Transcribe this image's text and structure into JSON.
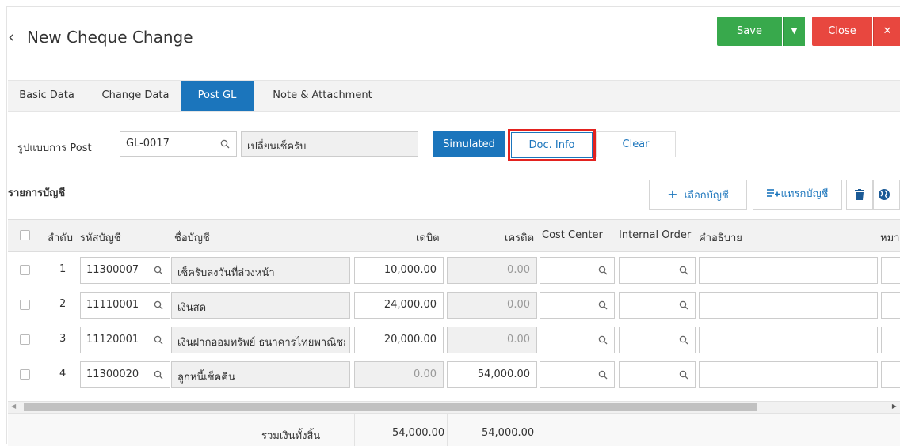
{
  "header": {
    "back_icon": "chevron-left-icon",
    "title": "New Cheque Change",
    "save_label": "Save",
    "close_label": "Close",
    "save_color": "#38a94c",
    "close_color": "#e8473f"
  },
  "tabs": [
    {
      "label": "Basic Data"
    },
    {
      "label": "Change Data"
    },
    {
      "label": "Post GL",
      "active": true
    },
    {
      "label": "Note & Attachment"
    }
  ],
  "post": {
    "label": "รูปแบบการ Post",
    "code": "GL-0017",
    "name": "เปลี่ยนเช็ครับ",
    "simulated_label": "Simulated",
    "docinfo_label": "Doc. Info",
    "clear_label": "Clear",
    "accent": "#1b75bc"
  },
  "accounts": {
    "title": "รายการบัญชี",
    "select_label": "เลือกบัญชี",
    "insert_label": "แทรกบัญชี",
    "columns": {
      "seq": "ลำดับ",
      "code": "รหัสบัญชี",
      "name": "ชื่อบัญชี",
      "debit": "เดบิต",
      "credit": "เครดิต",
      "cost_center": "Cost Center",
      "internal_order": "Internal Order",
      "desc": "คำอธิบาย",
      "note": "หมา"
    },
    "rows": [
      {
        "seq": "1",
        "code": "11300007",
        "name": "เช็ครับลงวันที่ล่วงหน้า",
        "debit": "10,000.00",
        "credit": "0.00"
      },
      {
        "seq": "2",
        "code": "11110001",
        "name": "เงินสด",
        "debit": "24,000.00",
        "credit": "0.00"
      },
      {
        "seq": "3",
        "code": "11120001",
        "name": "เงินฝากออมทรัพย์ ธนาคารไทยพาณิชย์",
        "debit": "20,000.00",
        "credit": "0.00"
      },
      {
        "seq": "4",
        "code": "11300020",
        "name": "ลูกหนี้เช็คคืน",
        "debit": "0.00",
        "credit": "54,000.00"
      }
    ],
    "total_label": "รวมเงินทั้งสิ้น",
    "total_debit": "54,000.00",
    "total_credit": "54,000.00"
  }
}
